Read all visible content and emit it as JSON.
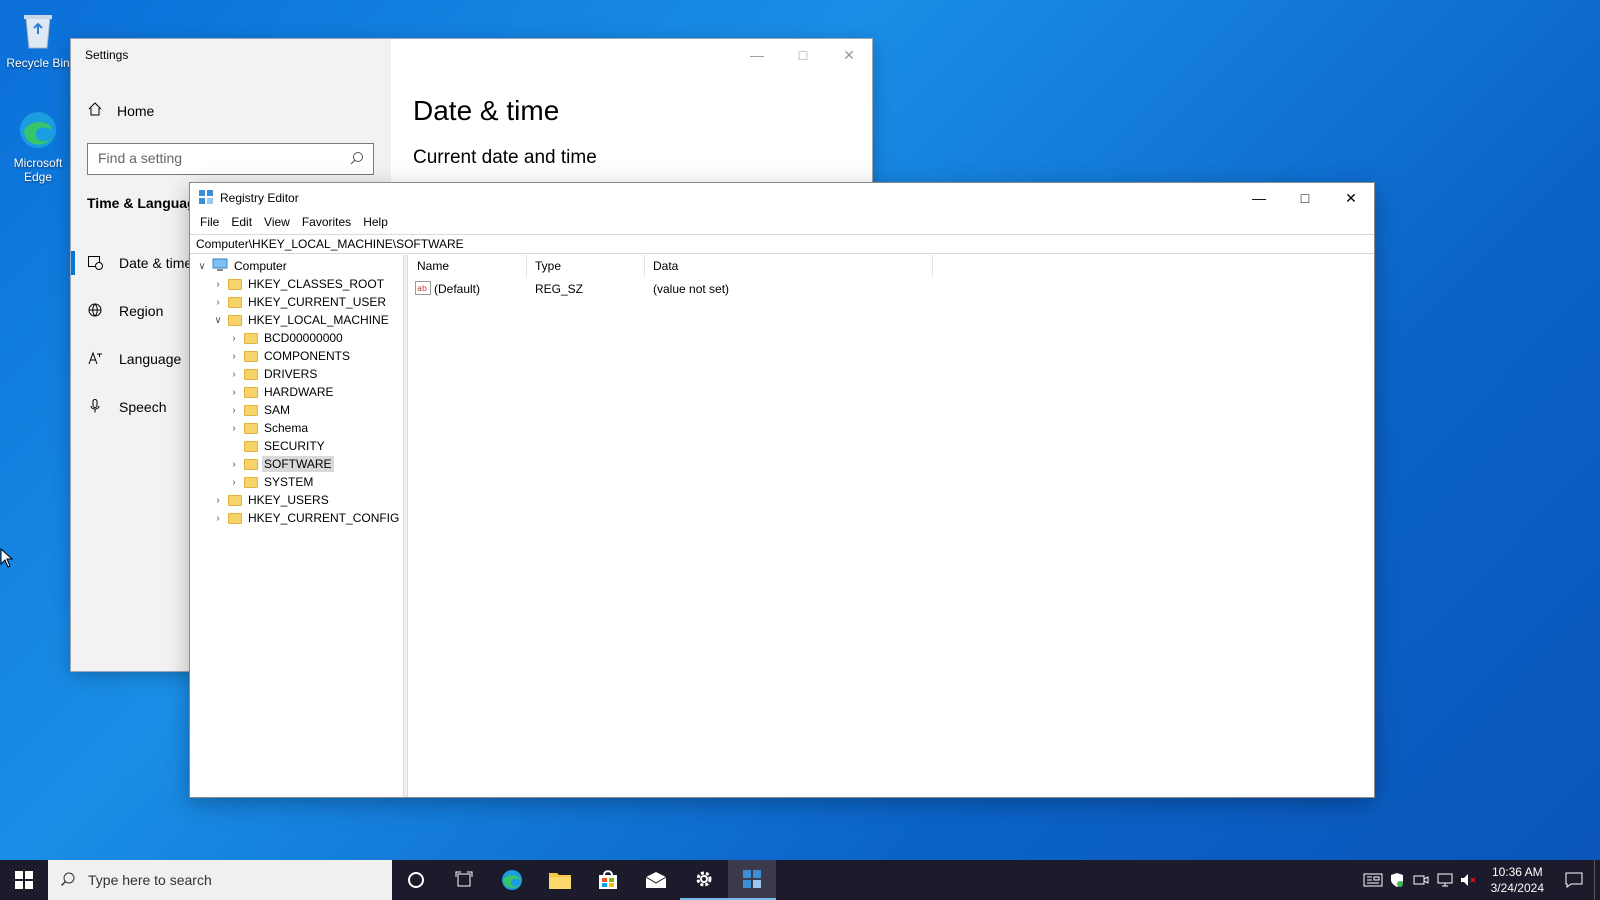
{
  "desktop": {
    "icons": [
      {
        "label": "Recycle Bin"
      },
      {
        "label": "Microsoft Edge"
      }
    ]
  },
  "settings": {
    "title": "Settings",
    "home": "Home",
    "search_placeholder": "Find a setting",
    "section": "Time & Language",
    "nav": [
      {
        "label": "Date & time",
        "active": true
      },
      {
        "label": "Region"
      },
      {
        "label": "Language"
      },
      {
        "label": "Speech"
      }
    ],
    "heading": "Date & time",
    "subheading": "Current date and time"
  },
  "regedit": {
    "title": "Registry Editor",
    "menu": [
      "File",
      "Edit",
      "View",
      "Favorites",
      "Help"
    ],
    "address": "Computer\\HKEY_LOCAL_MACHINE\\SOFTWARE",
    "tree": {
      "root": "Computer",
      "hives": [
        "HKEY_CLASSES_ROOT",
        "HKEY_CURRENT_USER",
        "HKEY_LOCAL_MACHINE"
      ],
      "hklm_children": [
        "BCD00000000",
        "COMPONENTS",
        "DRIVERS",
        "HARDWARE",
        "SAM",
        "Schema",
        "SECURITY",
        "SOFTWARE",
        "SYSTEM"
      ],
      "hives_after": [
        "HKEY_USERS",
        "HKEY_CURRENT_CONFIG"
      ],
      "selected": "SOFTWARE"
    },
    "columns": [
      "Name",
      "Type",
      "Data"
    ],
    "values": [
      {
        "name": "(Default)",
        "type": "REG_SZ",
        "data": "(value not set)"
      }
    ]
  },
  "taskbar": {
    "search_placeholder": "Type here to search",
    "time": "10:36 AM",
    "date": "3/24/2024"
  },
  "colors": {
    "accent": "#0078d7",
    "taskbar": "#1b1b2b",
    "desktop": "#0a6fd8"
  }
}
